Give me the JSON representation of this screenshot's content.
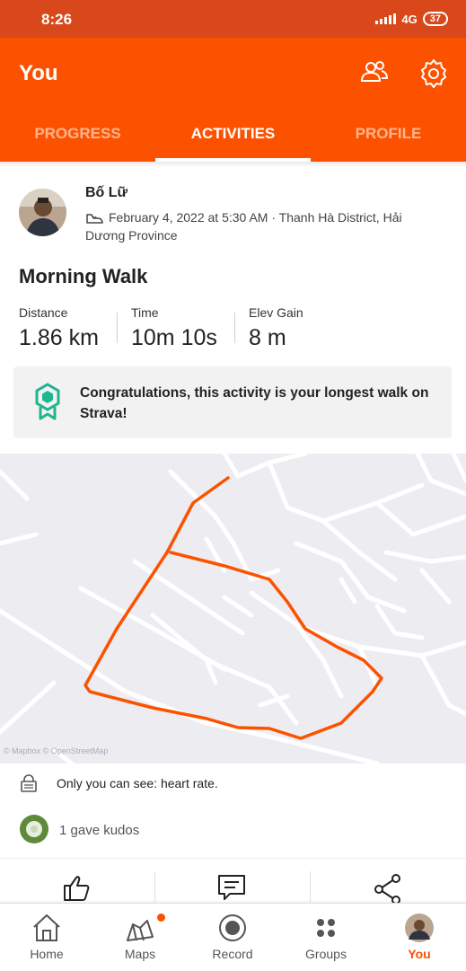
{
  "status_bar": {
    "time": "8:26",
    "network": "4G",
    "battery": "37"
  },
  "header": {
    "title": "You",
    "friends_icon": "people-icon",
    "settings_icon": "gear-icon"
  },
  "tabs": [
    {
      "label": "PROGRESS",
      "active": false
    },
    {
      "label": "ACTIVITIES",
      "active": true
    },
    {
      "label": "PROFILE",
      "active": false
    }
  ],
  "activity": {
    "athlete_name": "Bố Lữ",
    "datetime": "February 4, 2022 at 5:30 AM",
    "location": "Thanh Hà District, Hải Dương Province",
    "title": "Morning Walk",
    "stats": [
      {
        "label": "Distance",
        "value": "1.86 km"
      },
      {
        "label": "Time",
        "value": "10m 10s"
      },
      {
        "label": "Elev Gain",
        "value": "8 m"
      }
    ],
    "achievement": "Congratulations, this activity is your longest walk on Strava!"
  },
  "map": {
    "attribution": "© Mapbox © OpenStreetMap",
    "route_color": "#fc5200"
  },
  "privacy_note": "Only you can see: heart rate.",
  "kudos": "1 gave kudos",
  "actions": [
    "thumbs-up-icon",
    "comment-icon",
    "share-icon"
  ],
  "bottom_nav": [
    {
      "label": "Home",
      "icon": "home-icon",
      "active": false
    },
    {
      "label": "Maps",
      "icon": "map-icon",
      "active": false,
      "notification": true
    },
    {
      "label": "Record",
      "icon": "record-icon",
      "active": false
    },
    {
      "label": "Groups",
      "icon": "groups-icon",
      "active": false
    },
    {
      "label": "You",
      "icon": "avatar",
      "active": true
    }
  ],
  "colors": {
    "brand": "#fc5200",
    "status_bar": "#d8481a",
    "badge": "#1fb58f"
  }
}
